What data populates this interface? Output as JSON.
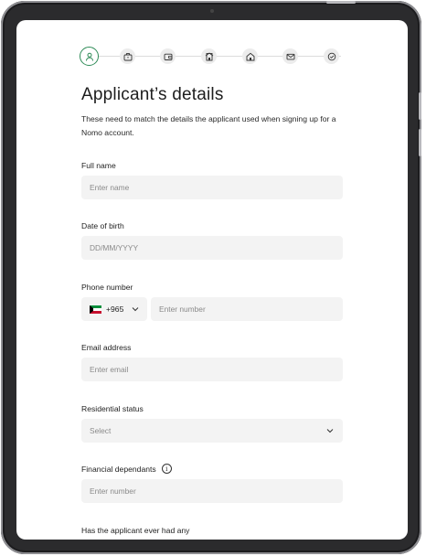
{
  "steps": [
    {
      "icon": "person-icon",
      "state": "active"
    },
    {
      "icon": "briefcase-icon",
      "state": "inactive"
    },
    {
      "icon": "wallet-icon",
      "state": "inactive"
    },
    {
      "icon": "building-icon",
      "state": "inactive"
    },
    {
      "icon": "home-icon",
      "state": "inactive"
    },
    {
      "icon": "mail-icon",
      "state": "inactive"
    },
    {
      "icon": "check-circle-icon",
      "state": "inactive"
    }
  ],
  "page": {
    "title": "Applicant’s details",
    "description": "These need to match the details the applicant used when signing up for a Nomo account."
  },
  "form": {
    "full_name": {
      "label": "Full name",
      "placeholder": "Enter name"
    },
    "dob": {
      "label": "Date of birth",
      "placeholder": "DD/MM/YYYY"
    },
    "phone": {
      "label": "Phone number",
      "country_code": "+965",
      "placeholder": "Enter number"
    },
    "email": {
      "label": "Email address",
      "placeholder": "Enter email"
    },
    "residential": {
      "label": "Residential status",
      "placeholder": "Select"
    },
    "dependants": {
      "label": "Financial dependants",
      "info": "i",
      "placeholder": "Enter number"
    },
    "history": {
      "label": "Has the applicant ever had any"
    }
  },
  "colors": {
    "accent": "#2e8b57",
    "field_bg": "#f3f3f3"
  }
}
